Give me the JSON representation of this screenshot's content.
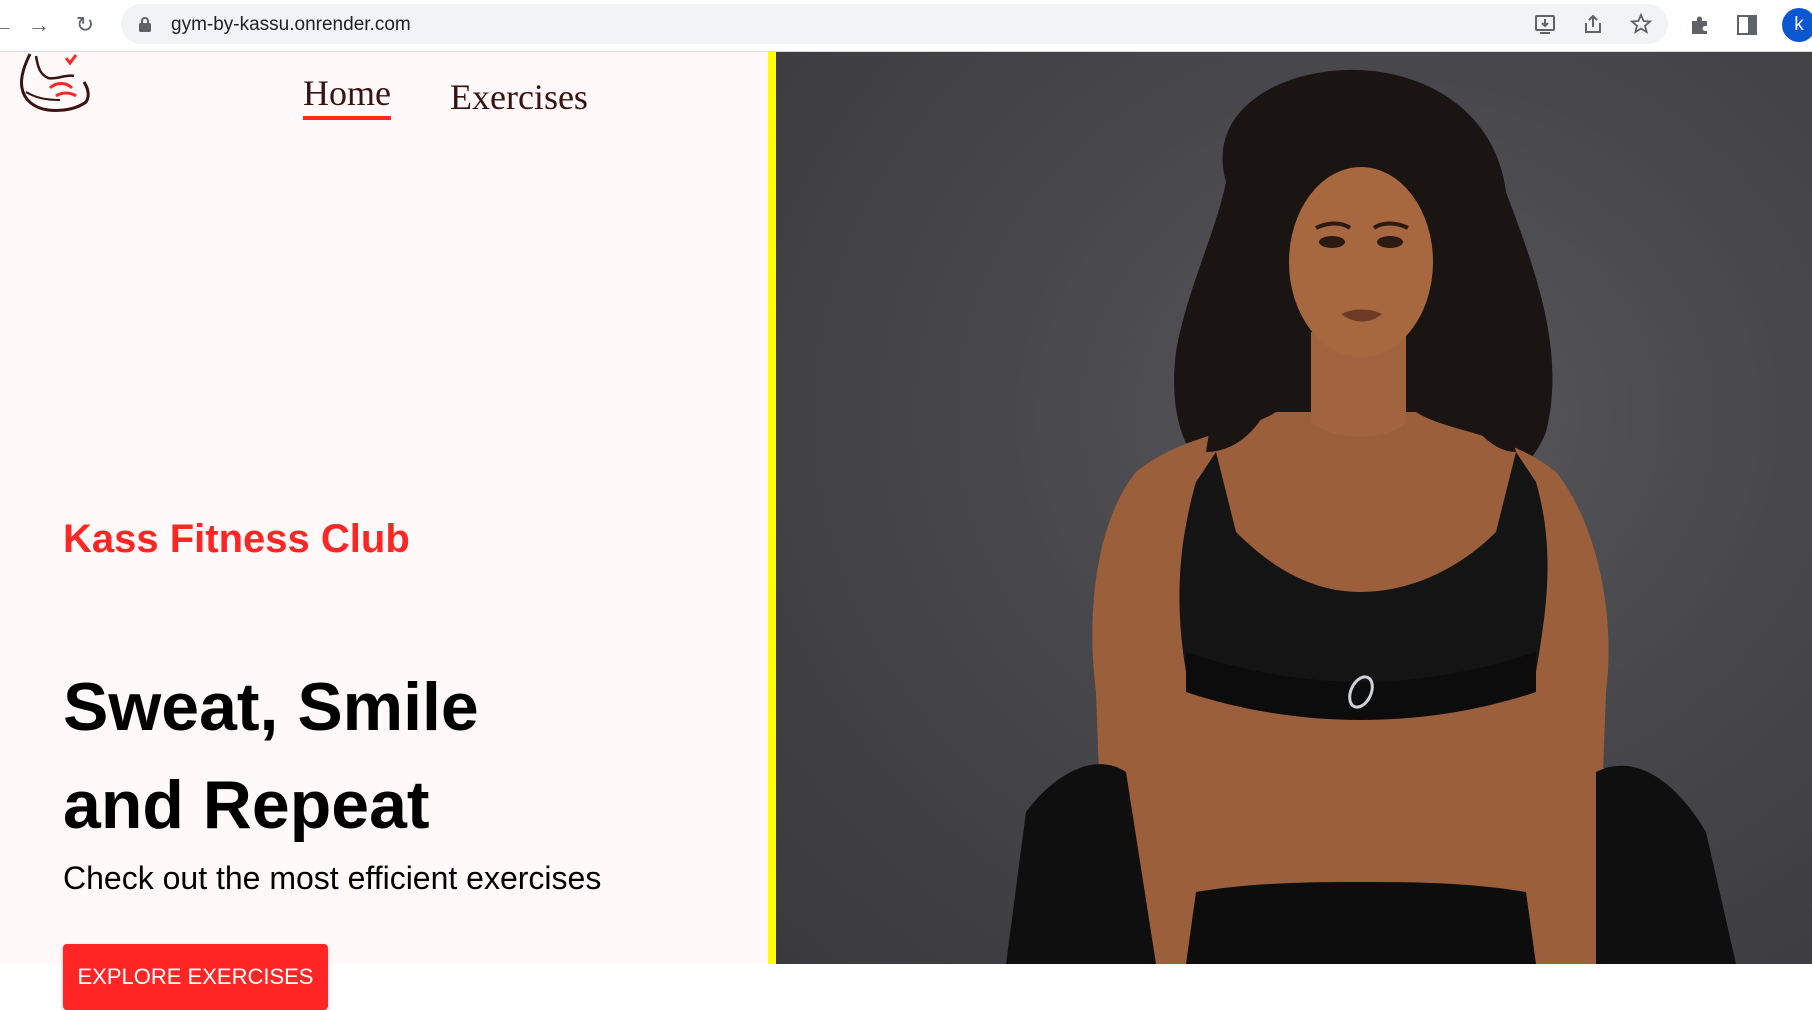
{
  "browser": {
    "url": "gym-by-kassu.onrender.com",
    "profile_initial": "k"
  },
  "nav": {
    "home_label": "Home",
    "exercises_label": "Exercises"
  },
  "hero": {
    "club_name": "Kass Fitness Club",
    "title_line1": "Sweat, Smile",
    "title_line2": "and Repeat",
    "description": "Check out the most efficient exercises",
    "cta_label": "EXPLORE EXERCISES"
  },
  "colors": {
    "accent": "#ff2625",
    "divider": "#ffff00",
    "page_bg": "#fff9f9"
  }
}
